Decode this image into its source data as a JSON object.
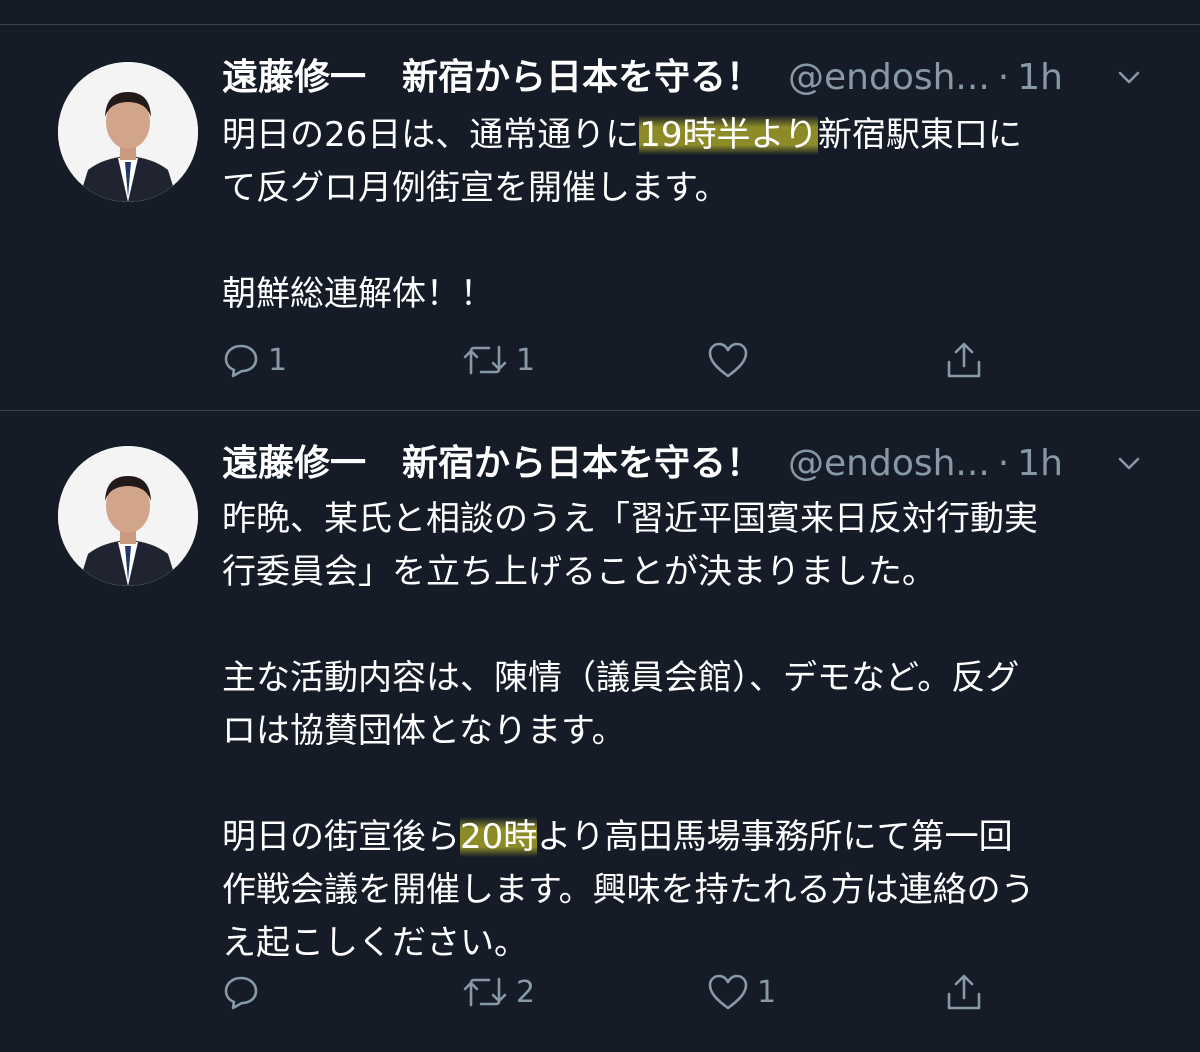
{
  "tweets": [
    {
      "display_name": "遠藤修一　新宿から日本を守る！",
      "handle": "@endosh...",
      "dot": "·",
      "time": "1h",
      "paragraphs": [
        {
          "lines": [
            {
              "pre": "明日の26日は、通常通りに",
              "hl": "19時半より",
              "post": "新宿駅東口に"
            },
            {
              "text": "て反グロ月例街宣を開催します。"
            }
          ]
        },
        {
          "lines": [
            {
              "text": "朝鮮総連解体！！"
            }
          ]
        }
      ],
      "counts": {
        "reply": "1",
        "retweet": "1",
        "like": ""
      },
      "icons": {
        "reply": "reply-icon",
        "retweet": "retweet-icon",
        "like": "heart-icon",
        "share": "share-icon",
        "caret": "chevron-down-icon"
      }
    },
    {
      "display_name": "遠藤修一　新宿から日本を守る！",
      "handle": "@endosh...",
      "dot": "·",
      "time": "1h",
      "paragraphs": [
        {
          "lines": [
            {
              "text": "昨晩、某氏と相談のうえ「習近平国賓来日反対行動実"
            },
            {
              "text": "行委員会」を立ち上げることが決まりました。"
            }
          ]
        },
        {
          "lines": [
            {
              "text": "主な活動内容は、陳情（議員会館）、デモなど。反グ"
            },
            {
              "text": "ロは協賛団体となります。"
            }
          ]
        },
        {
          "lines": [
            {
              "pre": "明日の街宣後ら",
              "hl": "20時",
              "post": "より高田馬場事務所にて第一回"
            },
            {
              "text": "作戦会議を開催します。興味を持たれる方は連絡のう"
            },
            {
              "text": "え起こしください。"
            }
          ]
        }
      ],
      "counts": {
        "reply": "",
        "retweet": "2",
        "like": "1"
      },
      "icons": {
        "reply": "reply-icon",
        "retweet": "retweet-icon",
        "like": "heart-icon",
        "share": "share-icon",
        "caret": "chevron-down-icon"
      }
    }
  ],
  "colors": {
    "background": "#151c28",
    "divider": "#38444d",
    "text": "#ffffff",
    "muted": "#8899a6",
    "highlight": "#f0e628"
  }
}
